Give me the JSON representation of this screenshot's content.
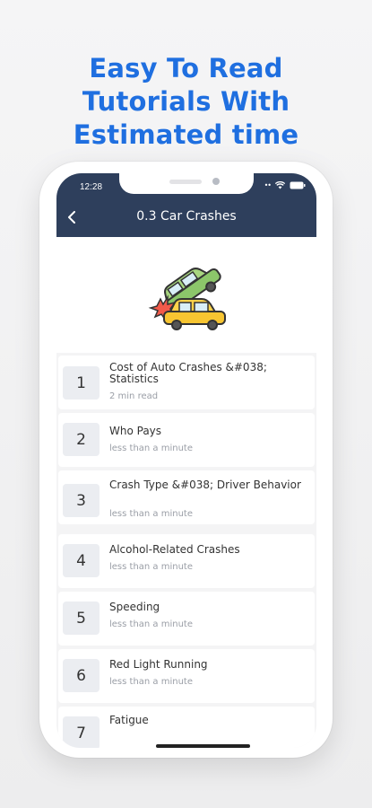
{
  "headline": {
    "line1": "Easy To Read",
    "line2": "Tutorials With",
    "line3": "Estimated time"
  },
  "status_bar": {
    "time": "12:28"
  },
  "nav": {
    "title": "0.3 Car Crashes",
    "back_icon": "chevron-left-icon"
  },
  "hero": {
    "icon": "car-crash-illustration"
  },
  "colors": {
    "headline": "#1f6fe0",
    "header_bg": "#2e3f5c",
    "number_tile": "#ebedf1",
    "subtitle": "#9a9ea6"
  },
  "lessons": [
    {
      "number": "1",
      "title": "Cost of Auto Crashes &#038; Statistics",
      "duration": "2 min read"
    },
    {
      "number": "2",
      "title": "Who Pays",
      "duration": "less than a minute"
    },
    {
      "number": "3",
      "title": "Crash Type &#038; Driver Behavior",
      "duration": "less than a minute"
    },
    {
      "number": "4",
      "title": "Alcohol-Related Crashes",
      "duration": "less than a minute"
    },
    {
      "number": "5",
      "title": "Speeding",
      "duration": "less than a minute"
    },
    {
      "number": "6",
      "title": "Red Light Running",
      "duration": "less than a minute"
    },
    {
      "number": "7",
      "title": "Fatigue",
      "duration": ""
    }
  ]
}
